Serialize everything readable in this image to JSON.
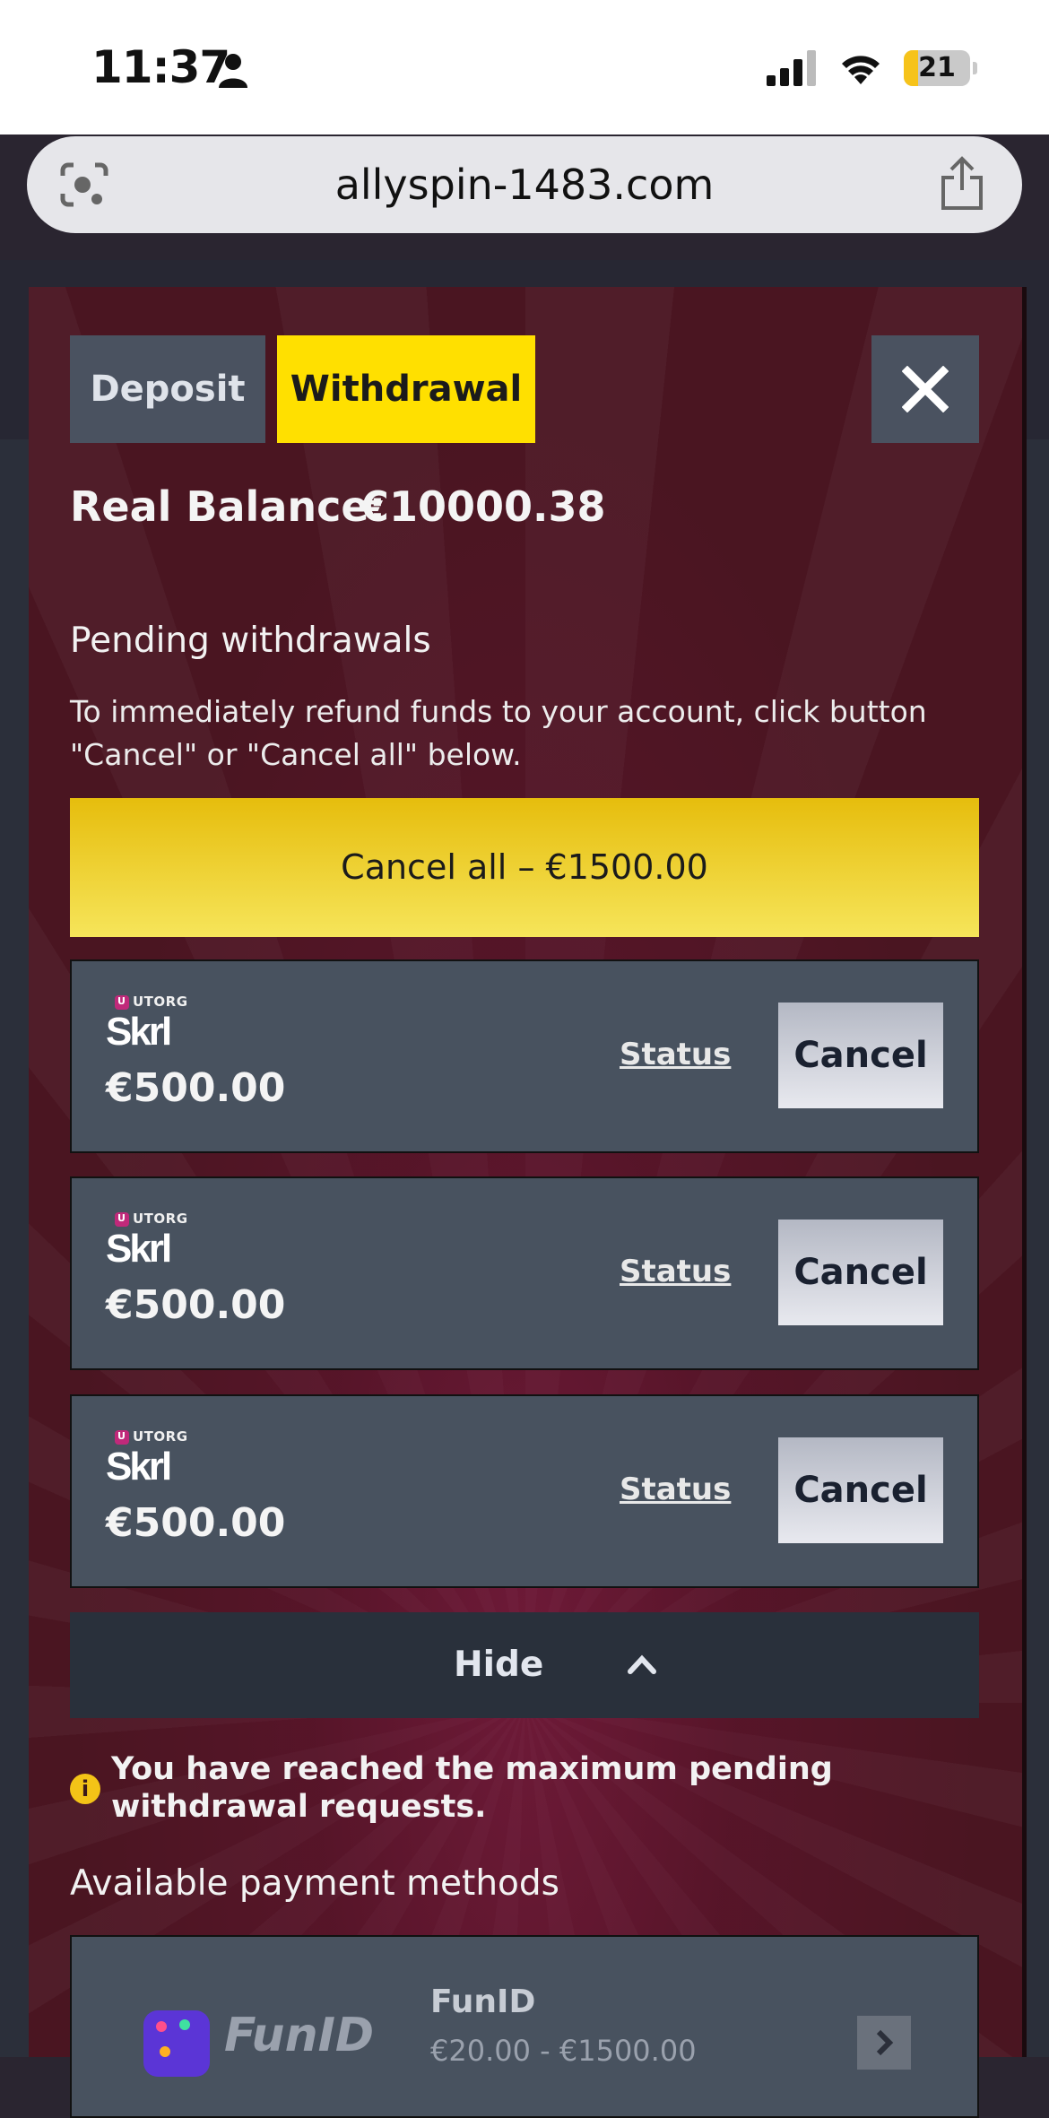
{
  "status_bar": {
    "time": "11:37",
    "battery": "21",
    "battery_level": 0.21
  },
  "browser": {
    "url": "allyspin-1483.com"
  },
  "tabs": {
    "deposit": "Deposit",
    "withdrawal": "Withdrawal",
    "active": "withdrawal"
  },
  "balance": {
    "label": "Real Balance:",
    "value": "€10000.38"
  },
  "pending": {
    "title": "Pending withdrawals",
    "description": "To immediately refund funds to your account, click button \"Cancel\" or \"Cancel all\" below.",
    "cancel_all": "Cancel all – €1500.00",
    "items": [
      {
        "provider_badge": "UTORG",
        "provider": "Skrl",
        "amount": "€500.00",
        "status": "Status",
        "cancel": "Cancel"
      },
      {
        "provider_badge": "UTORG",
        "provider": "Skrl",
        "amount": "€500.00",
        "status": "Status",
        "cancel": "Cancel"
      },
      {
        "provider_badge": "UTORG",
        "provider": "Skrl",
        "amount": "€500.00",
        "status": "Status",
        "cancel": "Cancel"
      }
    ],
    "hide": "Hide"
  },
  "notice": {
    "icon": "info-icon",
    "text": "You have reached the maximum pending withdrawal requests."
  },
  "methods": {
    "title": "Available payment methods",
    "items": [
      {
        "logo_text": "FunID",
        "name": "FunID",
        "range": "€20.00 - €1500.00"
      }
    ]
  },
  "colors": {
    "accent": "#ffe000",
    "modal_bg": "#4a1521",
    "card_bg": "#48525f"
  }
}
